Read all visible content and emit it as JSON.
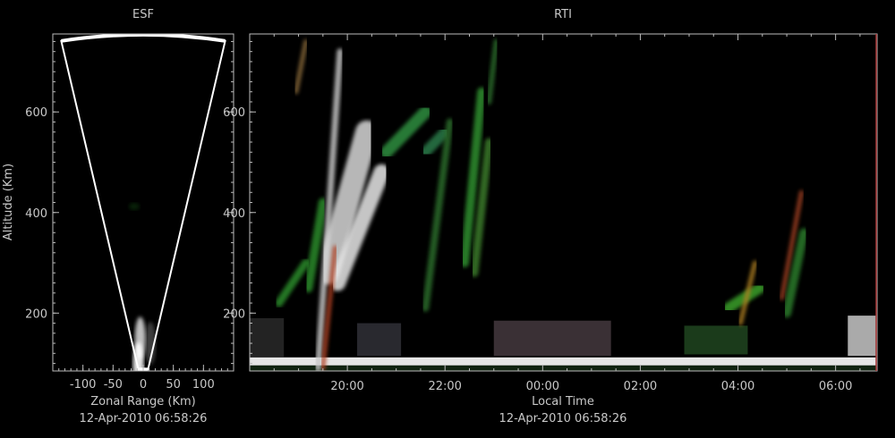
{
  "chart_data": [
    {
      "type": "heatmap",
      "panel": "esf",
      "title": "ESF",
      "xlabel": "Zonal Range (Km)",
      "ylabel": "Altitude (Km)",
      "subtitle": "12-Apr-2010 06:58:26",
      "xlim": [
        -150,
        150
      ],
      "ylim": [
        85,
        755
      ],
      "x_ticks": [
        -100,
        -50,
        0,
        50,
        100
      ],
      "y_ticks": [
        200,
        400,
        600
      ],
      "fan": {
        "apex_altitude_km": 88,
        "top_altitude_km": 750,
        "half_width_top_km": 136
      },
      "echoes": [
        {
          "x_km": -5,
          "alt_km": 150,
          "intensity": 0.85,
          "color": "#e0e0e0"
        },
        {
          "x_km": -8,
          "alt_km": 100,
          "intensity": 0.9,
          "color": "#ffffff"
        },
        {
          "x_km": 12,
          "alt_km": 140,
          "intensity": 0.4,
          "color": "#9a9a9a"
        },
        {
          "x_km": -15,
          "alt_km": 412,
          "intensity": 0.3,
          "color": "#1f6f1f"
        }
      ]
    },
    {
      "type": "heatmap",
      "panel": "rti",
      "title": "RTI",
      "xlabel": "Local Time",
      "ylabel": "Altitude (Km)",
      "subtitle": "12-Apr-2010 06:58:26",
      "x_unit": "hours since 18:00 local",
      "xlim_hours": [
        0,
        12.85
      ],
      "ylim": [
        85,
        755
      ],
      "x_ticks": [
        {
          "hour": 2,
          "label": "20:00"
        },
        {
          "hour": 4,
          "label": "22:00"
        },
        {
          "hour": 6,
          "label": "00:00"
        },
        {
          "hour": 8,
          "label": "02:00"
        },
        {
          "hour": 10,
          "label": "04:00"
        },
        {
          "hour": 12,
          "label": "06:00"
        }
      ],
      "y_ticks": [
        200,
        400,
        600
      ],
      "plumes": [
        {
          "t0": 1.55,
          "t1": 1.55,
          "alt0": 90,
          "alt1": 740,
          "color": "#2a2a2a",
          "width": 6
        },
        {
          "t0": 1.4,
          "t1": 1.85,
          "alt0": 90,
          "alt1": 720,
          "color": "#c8c8c8",
          "width": 7
        },
        {
          "t0": 1.6,
          "t1": 2.4,
          "alt0": 280,
          "alt1": 560,
          "color": "#d8d8d8",
          "width": 26
        },
        {
          "t0": 1.8,
          "t1": 2.7,
          "alt0": 260,
          "alt1": 480,
          "color": "#e8e8e8",
          "width": 18
        },
        {
          "t0": 1.5,
          "t1": 1.75,
          "alt0": 90,
          "alt1": 330,
          "color": "#b04020",
          "width": 5
        },
        {
          "t0": 1.2,
          "t1": 1.5,
          "alt0": 250,
          "alt1": 420,
          "color": "#2a8a2a",
          "width": 10
        },
        {
          "t0": 2.8,
          "t1": 3.6,
          "alt0": 520,
          "alt1": 600,
          "color": "#2f8f3f",
          "width": 14
        },
        {
          "t0": 3.6,
          "t1": 4.0,
          "alt0": 520,
          "alt1": 560,
          "color": "#2a7a4a",
          "width": 12
        },
        {
          "t0": 4.4,
          "t1": 4.75,
          "alt0": 300,
          "alt1": 640,
          "color": "#2f8f2f",
          "width": 10
        },
        {
          "t0": 4.6,
          "t1": 4.9,
          "alt0": 280,
          "alt1": 540,
          "color": "#3a7a2a",
          "width": 9
        },
        {
          "t0": 3.6,
          "t1": 4.1,
          "alt0": 210,
          "alt1": 580,
          "color": "#2a6a2a",
          "width": 8
        },
        {
          "t0": 4.9,
          "t1": 5.05,
          "alt0": 620,
          "alt1": 740,
          "color": "#2a6a2a",
          "width": 6
        },
        {
          "t0": 10.9,
          "t1": 11.3,
          "alt0": 230,
          "alt1": 440,
          "color": "#a04020",
          "width": 5
        },
        {
          "t0": 11.0,
          "t1": 11.35,
          "alt0": 200,
          "alt1": 360,
          "color": "#2a7a2a",
          "width": 10
        },
        {
          "t0": 9.8,
          "t1": 10.45,
          "alt0": 210,
          "alt1": 250,
          "color": "#3aa02a",
          "width": 12
        },
        {
          "t0": 10.05,
          "t1": 10.35,
          "alt0": 180,
          "alt1": 300,
          "color": "#b08020",
          "width": 5
        },
        {
          "t0": 0.6,
          "t1": 1.15,
          "alt0": 220,
          "alt1": 300,
          "color": "#2a8a2a",
          "width": 9
        },
        {
          "t0": 0.95,
          "t1": 1.15,
          "alt0": 640,
          "alt1": 740,
          "color": "#8a6a3a",
          "width": 5
        }
      ],
      "bands": [
        {
          "t0": 0,
          "t1": 12.85,
          "alt0": 96,
          "alt1": 112,
          "color": "#ffffff",
          "opacity": 0.9
        },
        {
          "t0": 0,
          "t1": 0.7,
          "alt0": 112,
          "alt1": 190,
          "color": "#3a3a3a",
          "opacity": 0.6
        },
        {
          "t0": 2.2,
          "t1": 3.1,
          "alt0": 115,
          "alt1": 180,
          "color": "#4a4a55",
          "opacity": 0.55
        },
        {
          "t0": 5.0,
          "t1": 7.4,
          "alt0": 115,
          "alt1": 185,
          "color": "#6a5860",
          "opacity": 0.55
        },
        {
          "t0": 8.9,
          "t1": 10.2,
          "alt0": 118,
          "alt1": 175,
          "color": "#2a5a2a",
          "opacity": 0.65
        },
        {
          "t0": 12.25,
          "t1": 12.85,
          "alt0": 115,
          "alt1": 195,
          "color": "#c8c8c8",
          "opacity": 0.85
        },
        {
          "t0": 0,
          "t1": 12.85,
          "alt0": 85,
          "alt1": 96,
          "color": "#1a3a1a",
          "opacity": 0.6
        }
      ]
    }
  ]
}
